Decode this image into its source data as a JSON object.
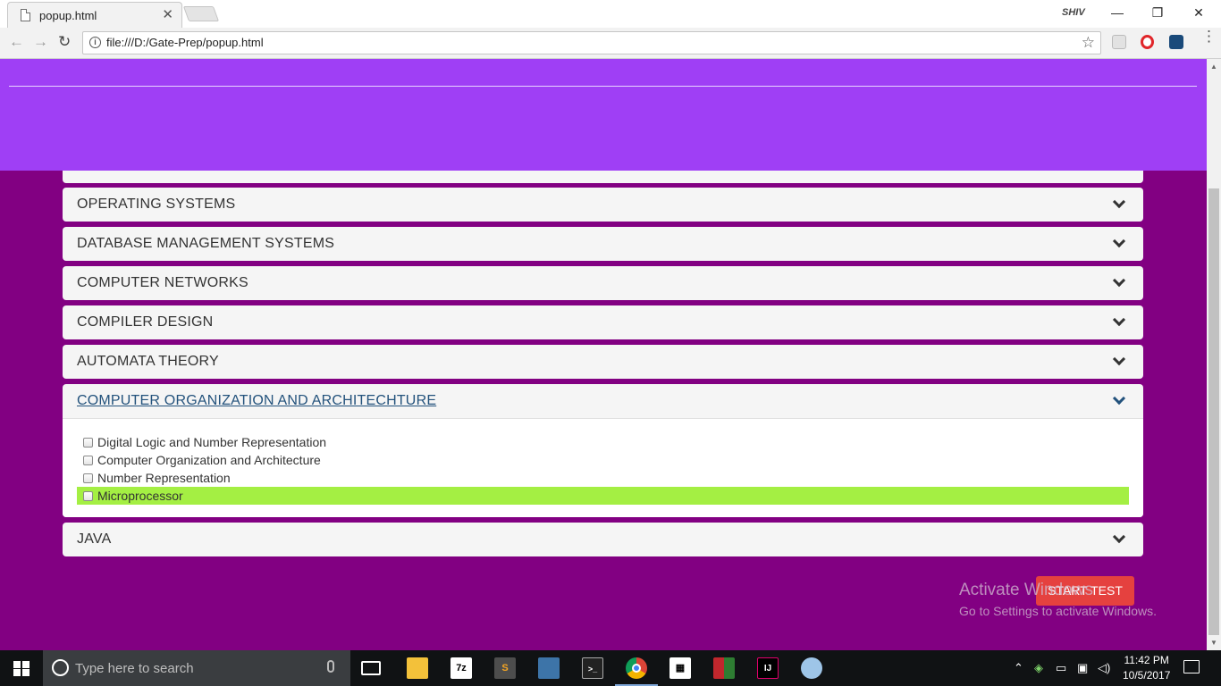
{
  "browser": {
    "tab_title": "popup.html",
    "tab_close": "✕",
    "profile": "SHIV",
    "window_controls": {
      "minimize": "—",
      "maximize": "❐",
      "close": "✕"
    },
    "nav": {
      "back": "←",
      "forward": "→",
      "reload": "↻"
    },
    "url": "file:///D:/Gate-Prep/popup.html",
    "star": "☆",
    "menu": "⋮"
  },
  "subjects": [
    "OPERATING SYSTEMS",
    "DATABASE MANAGEMENT SYSTEMS",
    "COMPUTER NETWORKS",
    "COMPILER DESIGN",
    "AUTOMATA THEORY",
    "COMPUTER ORGANIZATION AND ARCHITECHTURE",
    "JAVA"
  ],
  "open_subject": {
    "title": "COMPUTER ORGANIZATION AND ARCHITECHTURE",
    "topics": [
      {
        "label": "Digital Logic and Number Representation",
        "checked": false,
        "highlighted": false
      },
      {
        "label": "Computer Organization and Architecture",
        "checked": false,
        "highlighted": false
      },
      {
        "label": "Number Representation",
        "checked": false,
        "highlighted": false
      },
      {
        "label": "Microprocessor",
        "checked": false,
        "highlighted": true
      }
    ],
    "highlight_color": "#a4ef43"
  },
  "start_button": "START TEST",
  "watermark": {
    "line1": "Activate Windows",
    "line2": "Go to Settings to activate Windows."
  },
  "colors": {
    "page_background": "#820082",
    "hero": "#9f3ff5",
    "start_button": "#e5413f"
  },
  "taskbar": {
    "search_placeholder": "Type here to search",
    "time": "11:42 PM",
    "date": "10/5/2017",
    "apps": [
      "task-view-icon",
      "file-explorer-icon",
      "7zip-icon",
      "sublime-text-icon",
      "python-icon",
      "terminal-icon",
      "chrome-icon",
      "calculator-icon",
      "winrar-icon",
      "intellij-icon",
      "paint-icon"
    ]
  }
}
